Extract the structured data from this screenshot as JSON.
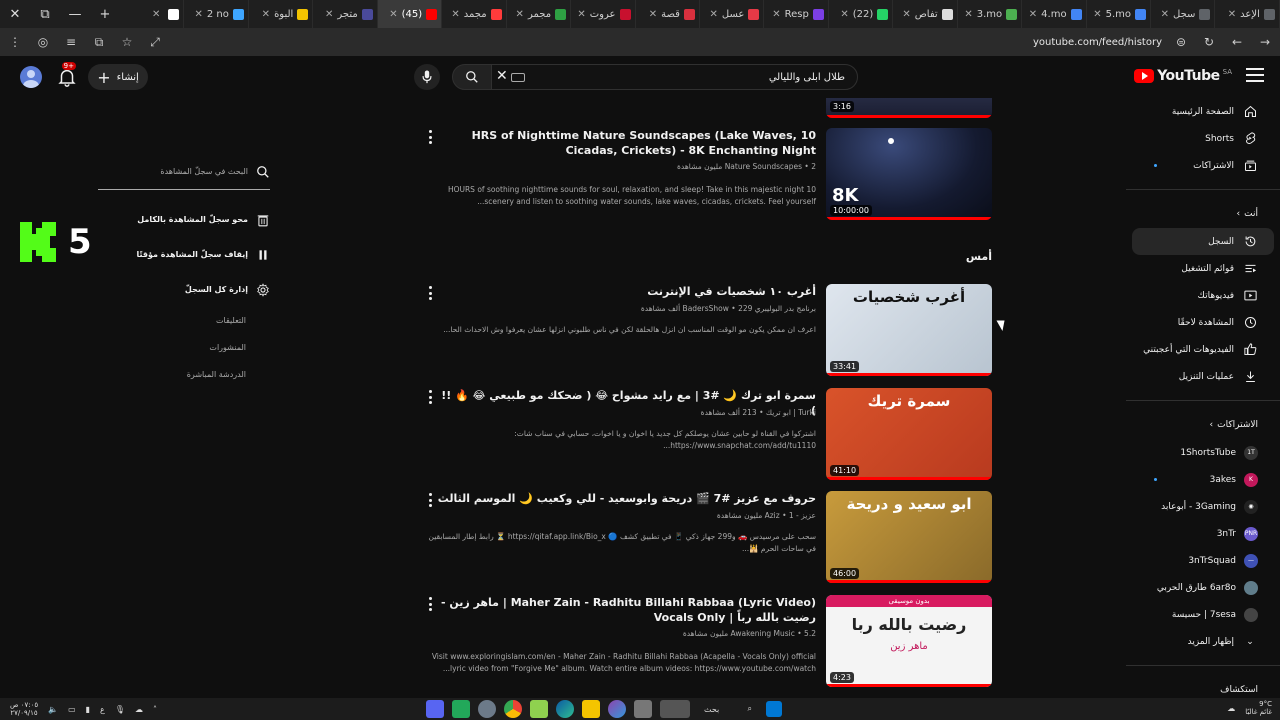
{
  "browser": {
    "tabs": [
      {
        "label": "",
        "color": "#ffffff"
      },
      {
        "label": "2 no",
        "color": "#3ea6ff"
      },
      {
        "label": "البوة",
        "color": "#f4c400"
      },
      {
        "label": "متجر",
        "color": "#4a4a9a"
      },
      {
        "label": "(45)",
        "color": "#ff0000",
        "active": true
      },
      {
        "label": "مجمد",
        "color": "#ff3b3b"
      },
      {
        "label": "مجمر",
        "color": "#2ea043"
      },
      {
        "label": "عروت",
        "color": "#c8102e"
      },
      {
        "label": "قصة",
        "color": "#d9303e"
      },
      {
        "label": "عسل",
        "color": "#e63946"
      },
      {
        "label": "Resp",
        "color": "#7b3fe4"
      },
      {
        "label": "(22)",
        "color": "#25d366"
      },
      {
        "label": "تفاص",
        "color": "#dddddd"
      },
      {
        "label": "3.mo",
        "color": "#4caf50"
      },
      {
        "label": "4.mo",
        "color": "#4285f4"
      },
      {
        "label": "5.mo",
        "color": "#4285f4"
      },
      {
        "label": "سجل",
        "color": "#5f6368"
      },
      {
        "label": "الإعد",
        "color": "#5f6368"
      }
    ],
    "url": "youtube.com/feed/history"
  },
  "header": {
    "logo_text": "YouTube",
    "logo_region": "SA",
    "search_query": "طلال ابلى والليالي",
    "create_label": "إنشاء",
    "notif_badge": "9+"
  },
  "sidebar": {
    "top_items": [
      {
        "label": "الصفحة الرئيسية",
        "icon": "home-icon"
      },
      {
        "label": "Shorts",
        "icon": "shorts-icon"
      },
      {
        "label": "الاشتراكات",
        "icon": "subscriptions-icon",
        "dot": true
      }
    ],
    "you_heading": "أنت",
    "you_items": [
      {
        "label": "السجل",
        "icon": "history-icon",
        "active": true
      },
      {
        "label": "قوائم التشغيل",
        "icon": "playlist-icon"
      },
      {
        "label": "فيديوهاتك",
        "icon": "your-videos-icon"
      },
      {
        "label": "المشاهدة لاحقًا",
        "icon": "watch-later-icon"
      },
      {
        "label": "الفيديوهات التي أعجبتني",
        "icon": "like-icon"
      },
      {
        "label": "عمليات التنزيل",
        "icon": "download-icon"
      }
    ],
    "subs_heading": "الاشتراكات",
    "channels": [
      {
        "label": "1ShortsTube",
        "color": "#333333",
        "initial": "1T"
      },
      {
        "label": "3akes",
        "color": "#c2185b",
        "initial": "K",
        "dot": true
      },
      {
        "label": "3Gaming - أبوعابد",
        "color": "#222222",
        "initial": "◉"
      },
      {
        "label": "3nTr",
        "color": "#6a5acd",
        "initial": "PNR"
      },
      {
        "label": "3nTrSquad",
        "color": "#3f51b5",
        "initial": "—"
      },
      {
        "label": "6ar8o طارق الحربي",
        "color": "#607d8b",
        "initial": ""
      },
      {
        "label": "7sesa | حسيسة",
        "color": "#444444",
        "initial": ""
      }
    ],
    "show_more": "إظهار المزيد",
    "explore_heading": "استكشاف"
  },
  "main": {
    "top_partial_duration": "3:16",
    "videos_today": [
      {
        "title": "10 HRS of Nighttime Nature Soundscapes (Lake Waves, Cicadas, Crickets) - 8K Enchanting Night",
        "meta": "Nature Soundscapes • 2 مليون مشاهدة",
        "desc": "10 HOURS of soothing nighttime sounds for soul, relaxation, and sleep! Take in this majestic night scenery and listen to soothing water sounds, lake waves, cicadas, crickets. Feel yourself...",
        "duration": "10:00:00",
        "badge": "8K"
      }
    ],
    "date_heading": "أمس",
    "videos_yesterday": [
      {
        "title": "أغرب ١٠ شخصيات في الإنترنت",
        "meta": "برنامج بدر البوليبري BadersShow • 229 ألف مشاهدة",
        "desc": "اعرف ان ممكن يكون مو الوقت المناسب ان انزل هالحلقة لكن في ناس طلبوني انزلها عشان يعرفوا وش الاحداث الحا...",
        "duration": "33:41",
        "thumb_text": "أغرب شخصيات"
      },
      {
        "title": "سمرة ابو ترك 🌙 #3 | مع رايد مشواح 😂 ( ضحكك مو طبيعي 😂 🔥 !! )",
        "meta": "Turki | ابو تريك • 213 ألف مشاهدة",
        "desc": "اشتركوا في القناة لو حابين عشان يوصلكم كل جديد يا اخوان و يا اخوات، حسابي في سناب شات: https://www.snapchat.com/add/tu1110...",
        "duration": "41:10",
        "thumb_text": "سمرة تريك"
      },
      {
        "title": "حروف مع عزيز #7 🎬 دريحة وابوسعيد - للي وكعيب 🌙 الموسم الثالث",
        "meta": "عزيز - Aziz • 1 مليون مشاهدة",
        "desc": "سحب على مرسيدس 🚗 و299 جهاز ذكي 📱 في تطبيق كشف 🔵 https://qitaf.app.link/Bio_x ⏳ رابط إطار المسابقين في ساحات الحرم 🕌...",
        "duration": "46:00",
        "thumb_text": "ابو سعيد و دريحة"
      },
      {
        "title": "Maher Zain - Radhitu Billahi Rabbaa (Lyric Video) | ماهر زين - رضيت بالله رباً | Vocals Only",
        "meta": "Awakening Music • 5.2 مليون مشاهدة",
        "desc": "Visit www.exploringislam.com/en - Maher Zain - Radhitu Billahi Rabbaa (Acapella - Vocals Only) official lyric video from \"Forgive Me\" album. Watch entire album videos: https://www.youtube.com/watch...",
        "duration": "4:23",
        "thumb_text": "رضيت بالله ربا",
        "thumb_sub": "ماهر زين",
        "thumb_badge": "بدون موسيقى"
      }
    ]
  },
  "history_panel": {
    "search_placeholder": "البحث في سجلّ المشاهدة",
    "clear_all": "محو سجلّ المشاهدة بالكامل",
    "pause": "إيقاف سجلّ المشاهدة مؤقتًا",
    "manage": "إدارة كل السجلّ",
    "sub_items": [
      "التعليقات",
      "المنشورات",
      "الدردشة المباشرة"
    ]
  },
  "overlay": {
    "counter": "5",
    "logo_color": "#53fc18"
  },
  "taskbar": {
    "search_label": "بحث",
    "weather_temp": "9°C",
    "weather_desc": "غائم غالبًا",
    "time": "٠٧:٠٥ ص",
    "date": "٢٧/٠٩/١٥",
    "lang": "ع"
  }
}
